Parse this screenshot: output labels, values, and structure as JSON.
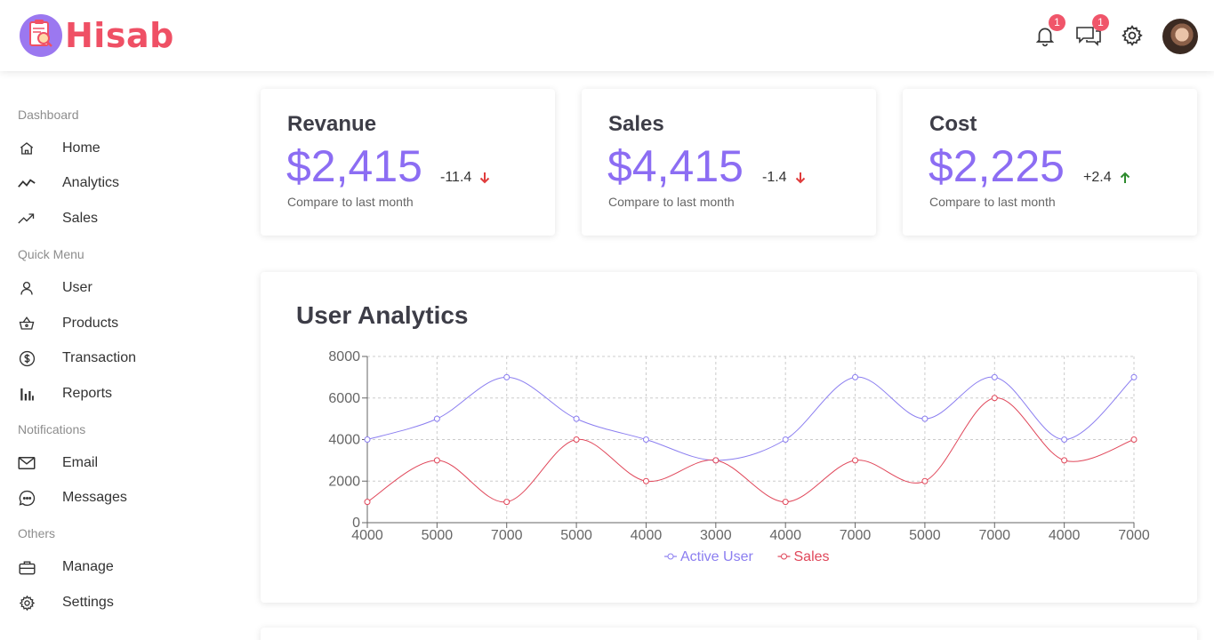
{
  "header": {
    "logo_text": "Hisab",
    "notifications_count": "1",
    "messages_count": "1"
  },
  "sidebar": {
    "sections": [
      {
        "title": "Dashboard",
        "items": [
          {
            "label": "Home",
            "icon": "home-icon"
          },
          {
            "label": "Analytics",
            "icon": "analytics-icon"
          },
          {
            "label": "Sales",
            "icon": "trending-up-icon"
          }
        ]
      },
      {
        "title": "Quick Menu",
        "items": [
          {
            "label": "User",
            "icon": "user-icon"
          },
          {
            "label": "Products",
            "icon": "basket-icon"
          },
          {
            "label": "Transaction",
            "icon": "dollar-icon"
          },
          {
            "label": "Reports",
            "icon": "bar-chart-icon"
          }
        ]
      },
      {
        "title": "Notifications",
        "items": [
          {
            "label": "Email",
            "icon": "mail-icon"
          },
          {
            "label": "Messages",
            "icon": "chat-icon"
          }
        ]
      },
      {
        "title": "Others",
        "items": [
          {
            "label": "Manage",
            "icon": "briefcase-icon"
          },
          {
            "label": "Settings",
            "icon": "settings-icon"
          }
        ]
      }
    ]
  },
  "stats": [
    {
      "title": "Revanue",
      "value": "$2,415",
      "rate": "-11.4",
      "direction": "down",
      "subtitle": "Compare to last month"
    },
    {
      "title": "Sales",
      "value": "$4,415",
      "rate": "-1.4",
      "direction": "down",
      "subtitle": "Compare to last month"
    },
    {
      "title": "Cost",
      "value": "$2,225",
      "rate": "+2.4",
      "direction": "up",
      "subtitle": "Compare to last month"
    }
  ],
  "colors": {
    "accent": "#8c6df3",
    "logo": "#ef5065",
    "active_user_line": "#8b7ef0",
    "sales_line": "#e0475a",
    "down_arrow": "#e03c3c",
    "up_arrow": "#2e8b2e"
  },
  "chart_data": {
    "type": "line",
    "title": "User Analytics",
    "categories": [
      "4000",
      "5000",
      "7000",
      "5000",
      "4000",
      "3000",
      "4000",
      "7000",
      "5000",
      "7000",
      "4000",
      "7000"
    ],
    "series": [
      {
        "name": "Active User",
        "values": [
          4000,
          5000,
          7000,
          5000,
          4000,
          3000,
          4000,
          7000,
          5000,
          7000,
          4000,
          7000
        ]
      },
      {
        "name": "Sales",
        "values": [
          1000,
          3000,
          1000,
          4000,
          2000,
          3000,
          1000,
          3000,
          2000,
          6000,
          3000,
          4000
        ]
      }
    ],
    "y_ticks": [
      "0",
      "2000",
      "4000",
      "6000",
      "8000"
    ],
    "ylim": [
      0,
      8000
    ],
    "grid": true,
    "legend": "bottom"
  }
}
